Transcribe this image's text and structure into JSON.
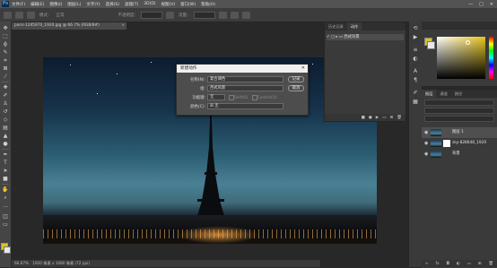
{
  "app": {
    "logo": "Ps"
  },
  "menu": [
    "文件(F)",
    "编辑(E)",
    "图像(I)",
    "图层(L)",
    "文字(Y)",
    "选择(S)",
    "滤镜(T)",
    "3D(D)",
    "视图(V)",
    "窗口(W)",
    "帮助(H)"
  ],
  "window_controls": [
    "—",
    "□",
    "✕"
  ],
  "options_bar": {
    "mode_label": "模式：",
    "mode_value": "正常",
    "opacity_label": "不透明度：",
    "flow_label": "流量："
  },
  "document": {
    "tab_title": "paris-1245970_1920.jpg @ 66.7% (RGB/8#)",
    "close": "×",
    "status_zoom": "66.67%",
    "status_size": "1920 像素 x 1080 像素 (72 ppi)"
  },
  "dialog": {
    "title": "新建动作",
    "close": "✕",
    "name_label": "名称(N):",
    "name_value": "复古调色",
    "set_label": "组:",
    "set_value": "西式风景",
    "fkey_label": "功能键:",
    "fkey_value": "无",
    "shift_label": "Shift(S)",
    "ctrl_label": "Control(O)",
    "color_label": "颜色(C):",
    "color_value": "无",
    "record_button": "记录",
    "cancel_button": "取消"
  },
  "actions_panel": {
    "tabs": [
      "历史记录",
      "动作"
    ],
    "active_tab": 1,
    "items": [
      {
        "label": "西式风景"
      }
    ]
  },
  "layers_panel": {
    "tabs": [
      "图层",
      "通道",
      "路径"
    ],
    "active_tab": 0,
    "layers": [
      {
        "name": "图层 1",
        "selected": true
      },
      {
        "name": "sky-828648_1920",
        "selected": false
      },
      {
        "name": "背景",
        "selected": false
      }
    ]
  },
  "colors": {
    "foreground": "#d9c22a",
    "background": "#e8e8e8",
    "accent": "#31a8ff"
  }
}
